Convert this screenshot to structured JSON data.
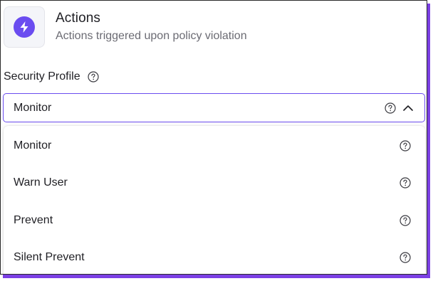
{
  "header": {
    "title": "Actions",
    "subtitle": "Actions triggered upon policy violation",
    "icon": "lightning-bolt-icon"
  },
  "field": {
    "label": "Security Profile",
    "selected_value": "Monitor",
    "expanded": true
  },
  "options": [
    {
      "label": "Monitor"
    },
    {
      "label": "Warn User"
    },
    {
      "label": "Prevent"
    },
    {
      "label": "Silent Prevent"
    }
  ],
  "colors": {
    "accent": "#6a4cf0",
    "frame_shadow": "#7b3fe4",
    "text_primary": "#1f1f24",
    "text_secondary": "#6b6b73"
  }
}
